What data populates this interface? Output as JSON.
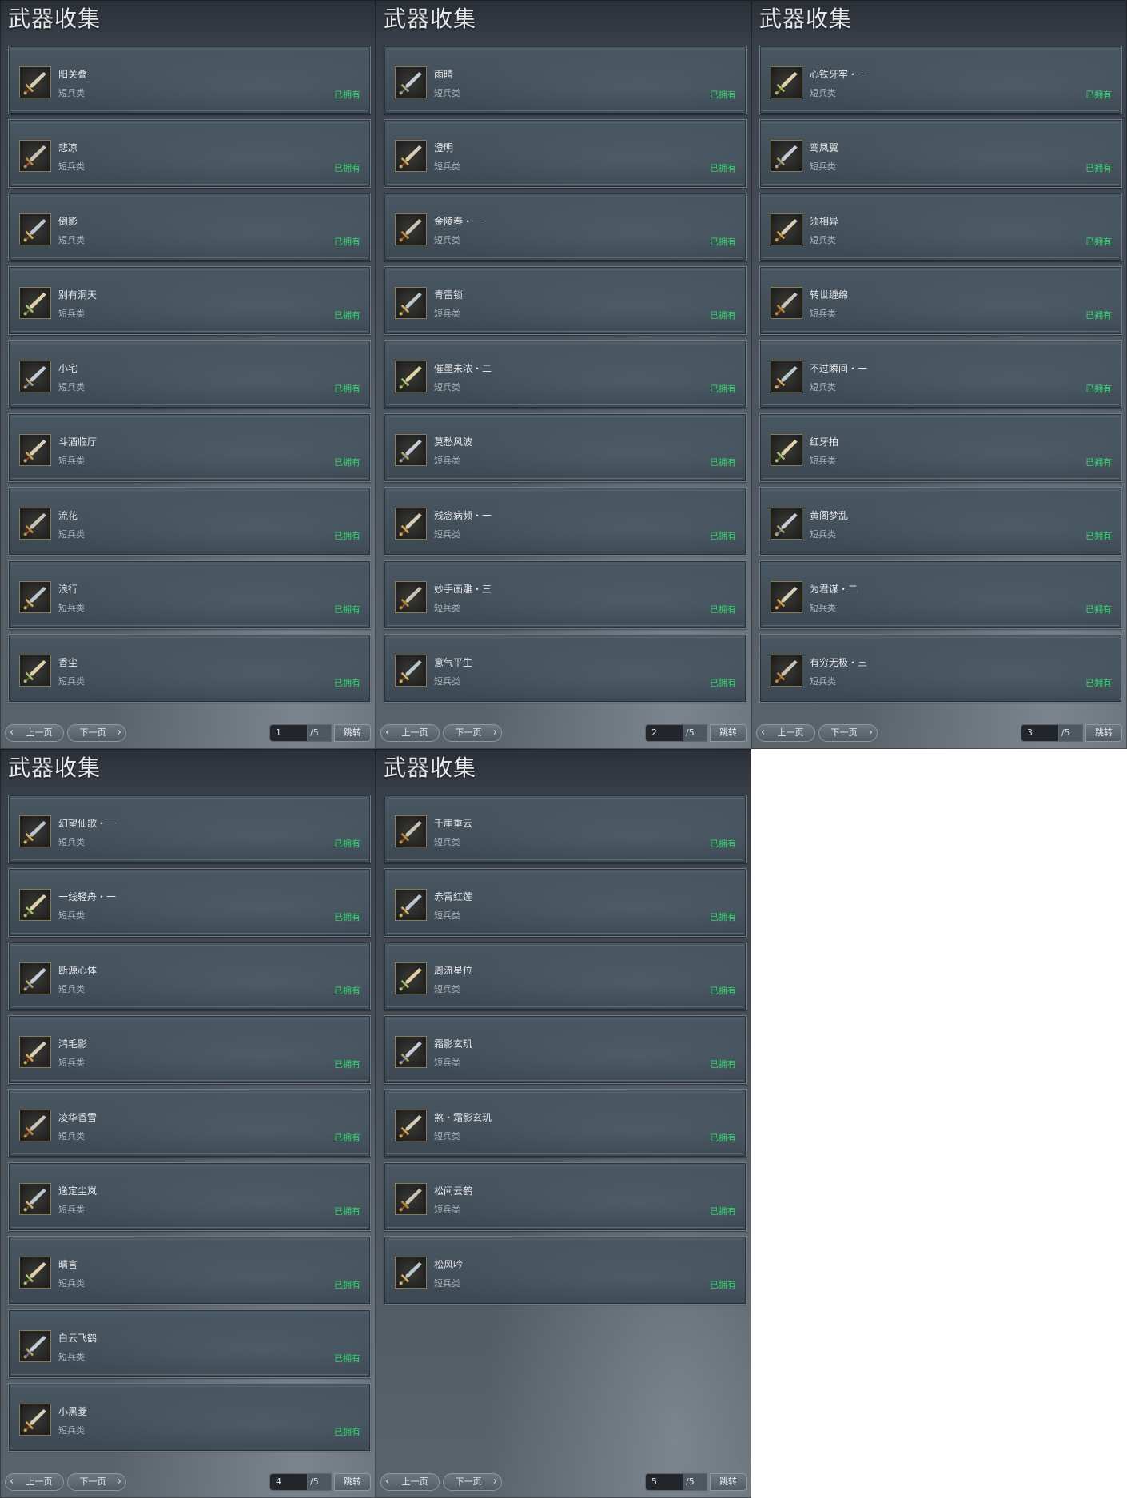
{
  "panels": [
    {
      "title": "武器收集",
      "items": [
        {
          "name": "阳关叠",
          "type": "短兵类",
          "status": "已拥有",
          "icon": "weapon-icon"
        },
        {
          "name": "悲凉",
          "type": "短兵类",
          "status": "已拥有",
          "icon": "weapon-icon"
        },
        {
          "name": "倒影",
          "type": "短兵类",
          "status": "已拥有",
          "icon": "weapon-icon"
        },
        {
          "name": "别有洞天",
          "type": "短兵类",
          "status": "已拥有",
          "icon": "weapon-icon"
        },
        {
          "name": "小宅",
          "type": "短兵类",
          "status": "已拥有",
          "icon": "weapon-icon"
        },
        {
          "name": "斗酒临厅",
          "type": "短兵类",
          "status": "已拥有",
          "icon": "weapon-icon"
        },
        {
          "name": "流花",
          "type": "短兵类",
          "status": "已拥有",
          "icon": "weapon-icon"
        },
        {
          "name": "浪行",
          "type": "短兵类",
          "status": "已拥有",
          "icon": "weapon-icon"
        },
        {
          "name": "香尘",
          "type": "短兵类",
          "status": "已拥有",
          "icon": "weapon-icon"
        }
      ],
      "pager": {
        "prev": "上一页",
        "next": "下一页",
        "page": "1",
        "total": "/5",
        "jump": "跳转"
      }
    },
    {
      "title": "武器收集",
      "items": [
        {
          "name": "雨晴",
          "type": "短兵类",
          "status": "已拥有",
          "icon": "weapon-icon"
        },
        {
          "name": "澄明",
          "type": "短兵类",
          "status": "已拥有",
          "icon": "weapon-icon"
        },
        {
          "name": "金陵春・一",
          "type": "短兵类",
          "status": "已拥有",
          "icon": "weapon-icon"
        },
        {
          "name": "青雷锁",
          "type": "短兵类",
          "status": "已拥有",
          "icon": "weapon-icon"
        },
        {
          "name": "催墨未浓・二",
          "type": "短兵类",
          "status": "已拥有",
          "icon": "weapon-icon"
        },
        {
          "name": "莫愁风波",
          "type": "短兵类",
          "status": "已拥有",
          "icon": "weapon-icon"
        },
        {
          "name": "残念病频・一",
          "type": "短兵类",
          "status": "已拥有",
          "icon": "weapon-icon"
        },
        {
          "name": "妙手画雕・三",
          "type": "短兵类",
          "status": "已拥有",
          "icon": "weapon-icon"
        },
        {
          "name": "意气平生",
          "type": "短兵类",
          "status": "已拥有",
          "icon": "weapon-icon"
        }
      ],
      "pager": {
        "prev": "上一页",
        "next": "下一页",
        "page": "2",
        "total": "/5",
        "jump": "跳转"
      }
    },
    {
      "title": "武器收集",
      "items": [
        {
          "name": "心铁牙牢・一",
          "type": "短兵类",
          "status": "已拥有",
          "icon": "weapon-icon"
        },
        {
          "name": "鸾凤翼",
          "type": "短兵类",
          "status": "已拥有",
          "icon": "weapon-icon"
        },
        {
          "name": "须相异",
          "type": "短兵类",
          "status": "已拥有",
          "icon": "weapon-icon"
        },
        {
          "name": "转世缠绵",
          "type": "短兵类",
          "status": "已拥有",
          "icon": "weapon-icon"
        },
        {
          "name": "不过瞬间・一",
          "type": "短兵类",
          "status": "已拥有",
          "icon": "weapon-icon"
        },
        {
          "name": "红牙拍",
          "type": "短兵类",
          "status": "已拥有",
          "icon": "weapon-icon"
        },
        {
          "name": "黄阁梦乱",
          "type": "短兵类",
          "status": "已拥有",
          "icon": "weapon-icon"
        },
        {
          "name": "为君谋・二",
          "type": "短兵类",
          "status": "已拥有",
          "icon": "weapon-icon"
        },
        {
          "name": "有穷无极・三",
          "type": "短兵类",
          "status": "已拥有",
          "icon": "weapon-icon"
        }
      ],
      "pager": {
        "prev": "上一页",
        "next": "下一页",
        "page": "3",
        "total": "/5",
        "jump": "跳转"
      }
    },
    {
      "title": "武器收集",
      "items": [
        {
          "name": "幻望仙歌・一",
          "type": "短兵类",
          "status": "已拥有",
          "icon": "weapon-icon"
        },
        {
          "name": "一线轻舟・一",
          "type": "短兵类",
          "status": "已拥有",
          "icon": "weapon-icon"
        },
        {
          "name": "断源心体",
          "type": "短兵类",
          "status": "已拥有",
          "icon": "weapon-icon"
        },
        {
          "name": "鸿毛影",
          "type": "短兵类",
          "status": "已拥有",
          "icon": "weapon-icon"
        },
        {
          "name": "凌华香雪",
          "type": "短兵类",
          "status": "已拥有",
          "icon": "weapon-icon"
        },
        {
          "name": "逸定尘岚",
          "type": "短兵类",
          "status": "已拥有",
          "icon": "weapon-icon"
        },
        {
          "name": "晴言",
          "type": "短兵类",
          "status": "已拥有",
          "icon": "weapon-icon"
        },
        {
          "name": "白云飞鹤",
          "type": "短兵类",
          "status": "已拥有",
          "icon": "weapon-icon"
        },
        {
          "name": "小黑菱",
          "type": "短兵类",
          "status": "已拥有",
          "icon": "weapon-icon"
        }
      ],
      "pager": {
        "prev": "上一页",
        "next": "下一页",
        "page": "4",
        "total": "/5",
        "jump": "跳转"
      }
    },
    {
      "title": "武器收集",
      "items": [
        {
          "name": "千崖重云",
          "type": "短兵类",
          "status": "已拥有",
          "icon": "weapon-icon"
        },
        {
          "name": "赤霄红莲",
          "type": "短兵类",
          "status": "已拥有",
          "icon": "weapon-icon"
        },
        {
          "name": "周流星位",
          "type": "短兵类",
          "status": "已拥有",
          "icon": "weapon-icon"
        },
        {
          "name": "霜影玄玑",
          "type": "短兵类",
          "status": "已拥有",
          "icon": "weapon-icon"
        },
        {
          "name": "煞・霜影玄玑",
          "type": "短兵类",
          "status": "已拥有",
          "icon": "weapon-icon"
        },
        {
          "name": "松间云鹤",
          "type": "短兵类",
          "status": "已拥有",
          "icon": "weapon-icon"
        },
        {
          "name": "松风吟",
          "type": "短兵类",
          "status": "已拥有",
          "icon": "weapon-icon"
        }
      ],
      "pager": {
        "prev": "上一页",
        "next": "下一页",
        "page": "5",
        "total": "/5",
        "jump": "跳转"
      }
    }
  ],
  "colors": {
    "owned": "#2fd36a",
    "title": "#e6e8ea"
  }
}
